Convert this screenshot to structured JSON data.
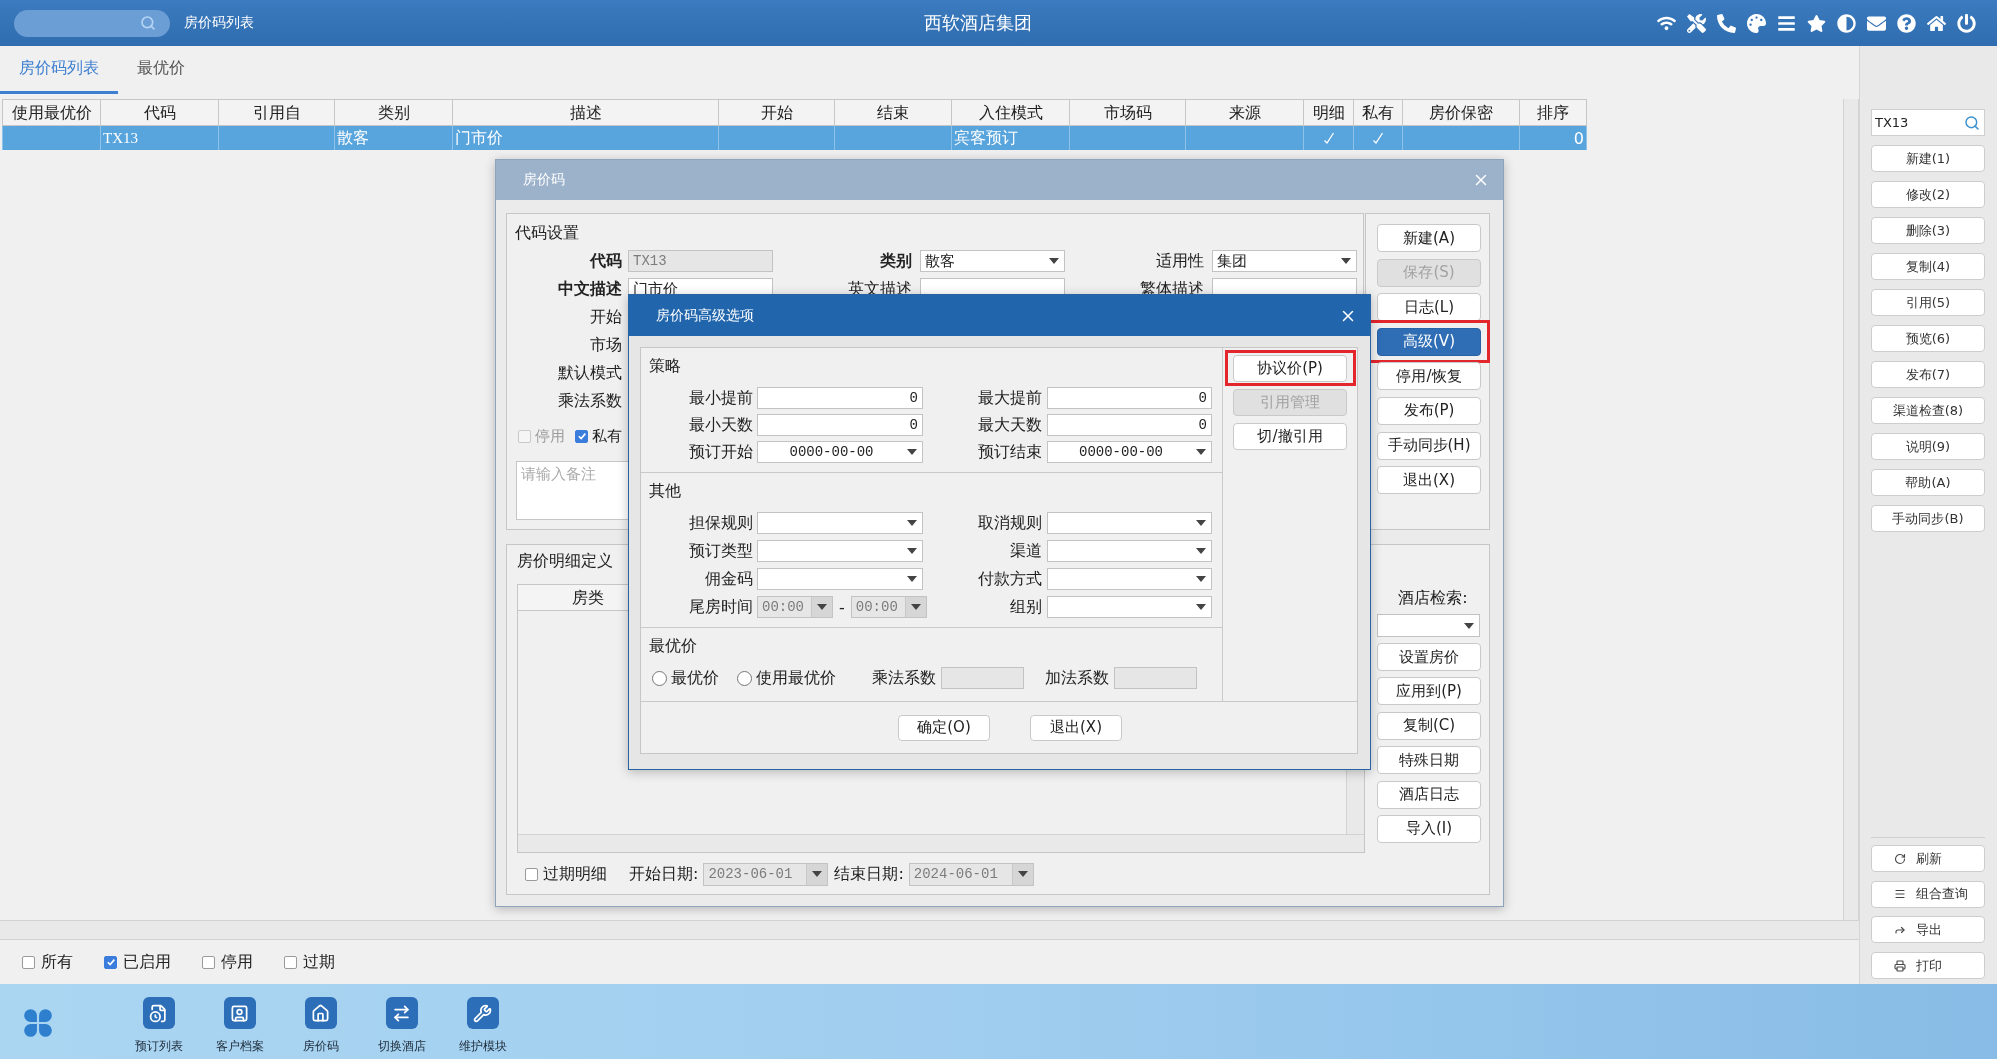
{
  "top_bar": {
    "module": "房价码列表",
    "title": "西软酒店集团"
  },
  "tabs": [
    {
      "label": "房价码列表",
      "selected": true
    },
    {
      "label": "最优价",
      "selected": false
    }
  ],
  "table": {
    "columns": [
      "使用最优价",
      "代码",
      "引用自",
      "类别",
      "描述",
      "开始",
      "结束",
      "入住模式",
      "市场码",
      "来源",
      "明细",
      "私有",
      "房价保密",
      "排序"
    ],
    "rows": [
      {
        "selected": true,
        "code": "TX13",
        "category": "散客",
        "description": "门市价",
        "checkin_mode": "宾客预订",
        "detail": true,
        "private": true,
        "sort": "0"
      }
    ]
  },
  "filters": [
    {
      "label": "所有",
      "checked": false
    },
    {
      "label": "已启用",
      "checked": true
    },
    {
      "label": "停用",
      "checked": false
    },
    {
      "label": "过期",
      "checked": false
    }
  ],
  "sidebar": {
    "search": {
      "value": "TX13"
    },
    "actions": [
      "新建(1)",
      "修改(2)",
      "删除(3)",
      "复制(4)",
      "引用(5)",
      "预览(6)",
      "发布(7)",
      "渠道检查(8)",
      "说明(9)",
      "帮助(A)",
      "手动同步(B)"
    ],
    "tools": [
      "刷新",
      "组合查询",
      "导出",
      "打印"
    ]
  },
  "taskbar": {
    "items": [
      "预订列表",
      "客户档案",
      "房价码",
      "切换酒店",
      "维护模块"
    ]
  },
  "rate_code_dialog": {
    "title": "房价码",
    "code_settings": {
      "heading": "代码设置",
      "fields": [
        {
          "label": "代码",
          "kind": "text",
          "value": "TX13",
          "required": true,
          "disabled": true
        },
        {
          "label": "类别",
          "kind": "select",
          "value": "散客",
          "required": true,
          "disabled": false
        },
        {
          "label": "适用性",
          "kind": "select",
          "value": "集团",
          "required": false,
          "disabled": false
        },
        {
          "label": "中文描述",
          "kind": "text",
          "value": "门市价",
          "required": true,
          "disabled": false
        },
        {
          "label": "英文描述",
          "kind": "text",
          "required": false,
          "disabled": false
        },
        {
          "label": "繁体描述",
          "kind": "text",
          "required": false,
          "disabled": false
        }
      ],
      "covered_labels": [
        "开始",
        "市场",
        "默认模式",
        "乘法系数"
      ],
      "options": [
        {
          "label": "停用",
          "checked": false,
          "disabled": true
        },
        {
          "label": "私有",
          "checked": true,
          "disabled": false
        }
      ],
      "remark": {
        "placeholder": "请输入备注"
      }
    },
    "buttons": [
      {
        "label": "新建(A)",
        "disabled": false,
        "active": false,
        "highlighted": false
      },
      {
        "label": "保存(S)",
        "disabled": true,
        "active": false,
        "highlighted": false
      },
      {
        "label": "日志(L)",
        "disabled": false,
        "active": false,
        "highlighted": false
      },
      {
        "label": "高级(V)",
        "disabled": false,
        "active": true,
        "highlighted": true
      },
      {
        "label": "停用/恢复",
        "disabled": false,
        "active": false,
        "highlighted": false
      },
      {
        "label": "发布(P)",
        "disabled": false,
        "active": false,
        "highlighted": false
      },
      {
        "label": "手动同步(H)",
        "disabled": false,
        "active": false,
        "highlighted": false
      },
      {
        "label": "退出(X)",
        "disabled": false,
        "active": false,
        "highlighted": false
      }
    ],
    "details": {
      "heading": "房价明细定义",
      "columns": [
        "房类"
      ],
      "expired": {
        "label": "过期明细",
        "checked": false
      },
      "start_date": {
        "label": "开始日期:",
        "value": "2023-06-01",
        "disabled": true
      },
      "end_date": {
        "label": "结束日期:",
        "value": "2024-06-01",
        "disabled": true
      },
      "hotel_search": {
        "label": "酒店检索:"
      },
      "buttons": [
        "设置房价",
        "应用到(P)",
        "复制(C)",
        "特殊日期",
        "酒店日志",
        "导入(I)"
      ]
    }
  },
  "advanced_dialog": {
    "title": "房价码高级选项",
    "sections": [
      {
        "heading": "策略",
        "fields": [
          {
            "label": "最小提前",
            "kind": "number",
            "value": "0",
            "disabled": false
          },
          {
            "label": "最大提前",
            "kind": "number",
            "value": "0",
            "disabled": false
          },
          {
            "label": "最小天数",
            "kind": "number",
            "value": "0",
            "disabled": false
          },
          {
            "label": "最大天数",
            "kind": "number",
            "value": "0",
            "disabled": false
          },
          {
            "label": "预订开始",
            "kind": "date",
            "value": "0000-00-00",
            "disabled": false
          },
          {
            "label": "预订结束",
            "kind": "date",
            "value": "0000-00-00",
            "disabled": false
          }
        ]
      },
      {
        "heading": "其他",
        "fields": [
          {
            "label": "担保规则",
            "kind": "select",
            "disabled": false
          },
          {
            "label": "取消规则",
            "kind": "select",
            "disabled": false
          },
          {
            "label": "预订类型",
            "kind": "select",
            "disabled": false
          },
          {
            "label": "渠道",
            "kind": "select",
            "disabled": false
          },
          {
            "label": "佣金码",
            "kind": "select",
            "disabled": false
          },
          {
            "label": "付款方式",
            "kind": "select",
            "disabled": false
          },
          {
            "label": "尾房时间",
            "kind": "time_range",
            "from": "00:00",
            "separator": "-",
            "to": "00:00",
            "disabled": true
          },
          {
            "label": "组别",
            "kind": "select",
            "disabled": false
          }
        ]
      }
    ],
    "best_price": {
      "heading": "最优价",
      "options": [
        {
          "label": "最优价",
          "selected": false
        },
        {
          "label": "使用最优价",
          "selected": false
        }
      ],
      "factors": [
        {
          "label": "乘法系数",
          "disabled": true
        },
        {
          "label": "加法系数",
          "disabled": true
        }
      ]
    },
    "side_buttons": [
      {
        "label": "协议价(P)",
        "disabled": false,
        "highlighted": true
      },
      {
        "label": "引用管理",
        "disabled": true,
        "highlighted": false
      },
      {
        "label": "切/撤引用",
        "disabled": false,
        "highlighted": false
      }
    ],
    "footer_buttons": [
      "确定(O)",
      "退出(X)"
    ]
  }
}
